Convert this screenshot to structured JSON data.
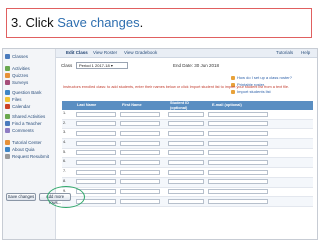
{
  "caption": {
    "prefix": "3. Click ",
    "highlight": "Save changes",
    "suffix": "."
  },
  "tabs": [
    {
      "label": "Edit Class",
      "active": true
    },
    {
      "label": "View Roster",
      "active": false
    },
    {
      "label": "View Gradebook",
      "active": false
    }
  ],
  "top_links": {
    "tutorials": "Tutorials",
    "help": "Help"
  },
  "sidebar": {
    "items": [
      {
        "label": "Classes",
        "icon": "classes-icon",
        "color": "#4a7bbd"
      },
      {
        "label": "Activities",
        "icon": "activities-icon",
        "color": "#6aa84f"
      },
      {
        "label": "Quizzes",
        "icon": "quizzes-icon",
        "color": "#e69138"
      },
      {
        "label": "Surveys",
        "icon": "surveys-icon",
        "color": "#a64d79"
      },
      {
        "label": "Question Bank",
        "icon": "question-bank-icon",
        "color": "#3d85c6"
      },
      {
        "label": "Files",
        "icon": "files-icon",
        "color": "#f1c232"
      },
      {
        "label": "Calendar",
        "icon": "calendar-icon",
        "color": "#cc4125"
      },
      {
        "label": "Shared Activities",
        "icon": "shared-icon",
        "color": "#6aa84f"
      },
      {
        "label": "Find a Teacher",
        "icon": "teacher-icon",
        "color": "#4a7bbd"
      },
      {
        "label": "Comments",
        "icon": "comments-icon",
        "color": "#8e7cc3"
      },
      {
        "label": "Tutorial Center",
        "icon": "tutorial-icon",
        "color": "#e69138"
      },
      {
        "label": "About Quia",
        "icon": "about-icon",
        "color": "#3d85c6"
      },
      {
        "label": "Request Resubmit",
        "icon": "request-icon",
        "color": "#999999"
      }
    ]
  },
  "class_row": {
    "label": "Class",
    "select_value": "Period 1 2017-18",
    "end_date_label": "End Date:",
    "end_date_value": "30 Jun 2018"
  },
  "help_links": [
    "How do I set up a class roster?",
    "Printable roster",
    "Import students list"
  ],
  "instructions": "Instructors enrolled class: to add students, enter their names below or click Import student list to import your student list from a text file.",
  "table": {
    "headers": [
      "Last Name",
      "First Name",
      "Student ID (optional)",
      "E-mail (optional)"
    ],
    "rows": [
      "1.",
      "2.",
      "3.",
      "4.",
      "5.",
      "6.",
      "7.",
      "8.",
      "9.",
      "10."
    ]
  },
  "buttons": {
    "save": "Save changes",
    "add_rows": "Add more rows..."
  },
  "colors": {
    "accent": "#2f6fb0",
    "header": "#5a8ec2",
    "highlight_circle": "#2fa86a",
    "caption_border": "#e06060"
  }
}
